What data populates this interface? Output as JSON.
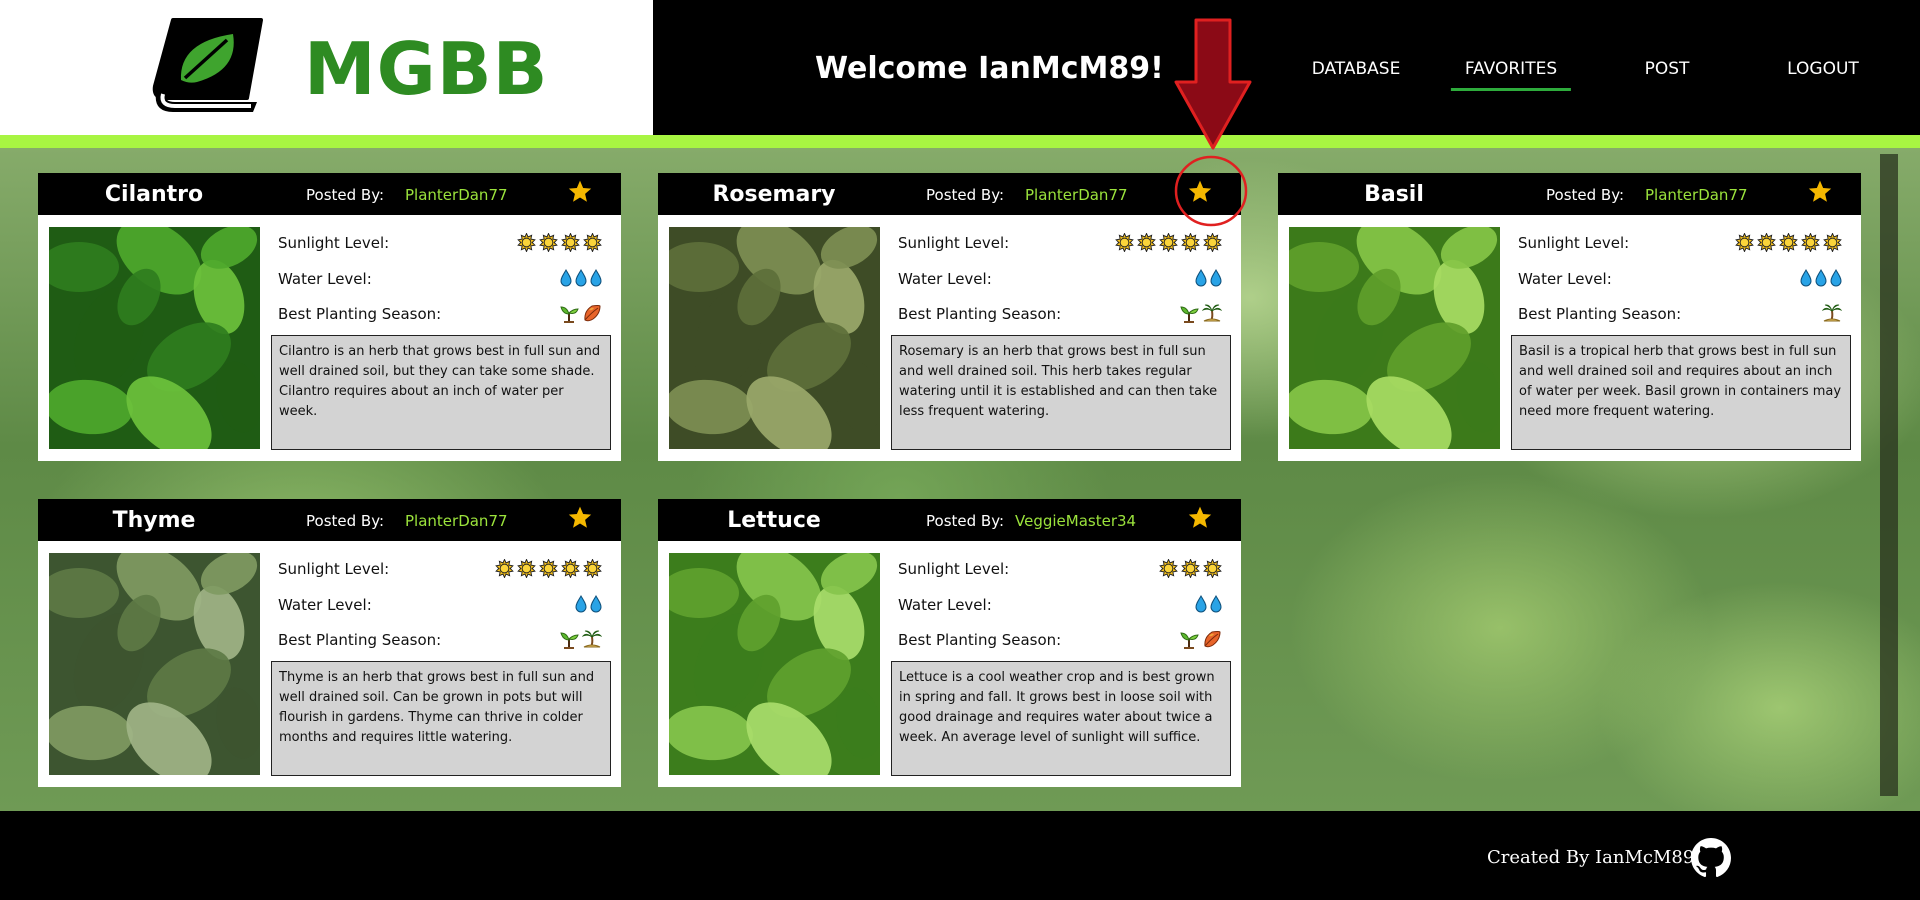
{
  "header": {
    "logo_text": "MGBB",
    "welcome": "Welcome IanMcM89!",
    "nav": [
      {
        "label": "DATABASE",
        "active": false
      },
      {
        "label": "FAVORITES",
        "active": true
      },
      {
        "label": "POST",
        "active": false
      },
      {
        "label": "LOGOUT",
        "active": false
      }
    ]
  },
  "labels": {
    "posted_by": "Posted By:",
    "sunlight": "Sunlight Level:",
    "water": "Water Level:",
    "season": "Best Planting Season:"
  },
  "cards": [
    {
      "name": "Cilantro",
      "poster": "PlanterDan77",
      "sunlight": 4,
      "water": 3,
      "seasons": [
        "spring",
        "fall"
      ],
      "description": "Cilantro is an herb that grows best in full sun and well drained soil, but they can take some shade. Cilantro requires about an inch of water per week."
    },
    {
      "name": "Rosemary",
      "poster": "PlanterDan77",
      "sunlight": 5,
      "water": 2,
      "seasons": [
        "spring",
        "summer"
      ],
      "description": "Rosemary is an herb that grows best in full sun and well drained soil. This herb takes regular watering until it is established and can then take less frequent watering."
    },
    {
      "name": "Basil",
      "poster": "PlanterDan77",
      "sunlight": 5,
      "water": 3,
      "seasons": [
        "summer"
      ],
      "description": "Basil is a tropical herb that grows best in full sun and well drained soil and requires about an inch of water per week. Basil grown in containers may need more frequent watering."
    },
    {
      "name": "Thyme",
      "poster": "PlanterDan77",
      "sunlight": 5,
      "water": 2,
      "seasons": [
        "spring",
        "summer"
      ],
      "description": "Thyme is an herb that grows best in full sun and well drained soil. Can be grown in pots but will flourish in gardens. Thyme can thrive in colder months and requires little watering."
    },
    {
      "name": "Lettuce",
      "poster": "VeggieMaster34",
      "sunlight": 3,
      "water": 2,
      "seasons": [
        "spring",
        "fall"
      ],
      "description": "Lettuce is a cool weather crop and is best grown in spring and fall. It grows best in loose soil with good drainage and requires water about twice a week. An average level of sunlight will suffice."
    }
  ],
  "footer": {
    "credit": "Created By IanMcM89",
    "icon": "github-icon"
  },
  "colors": {
    "brand_green": "#2e8b22",
    "accent_lime": "#a8f542",
    "poster_green": "#9be33c",
    "star": "#f5b800",
    "annotation_red": "#8b0a16"
  }
}
